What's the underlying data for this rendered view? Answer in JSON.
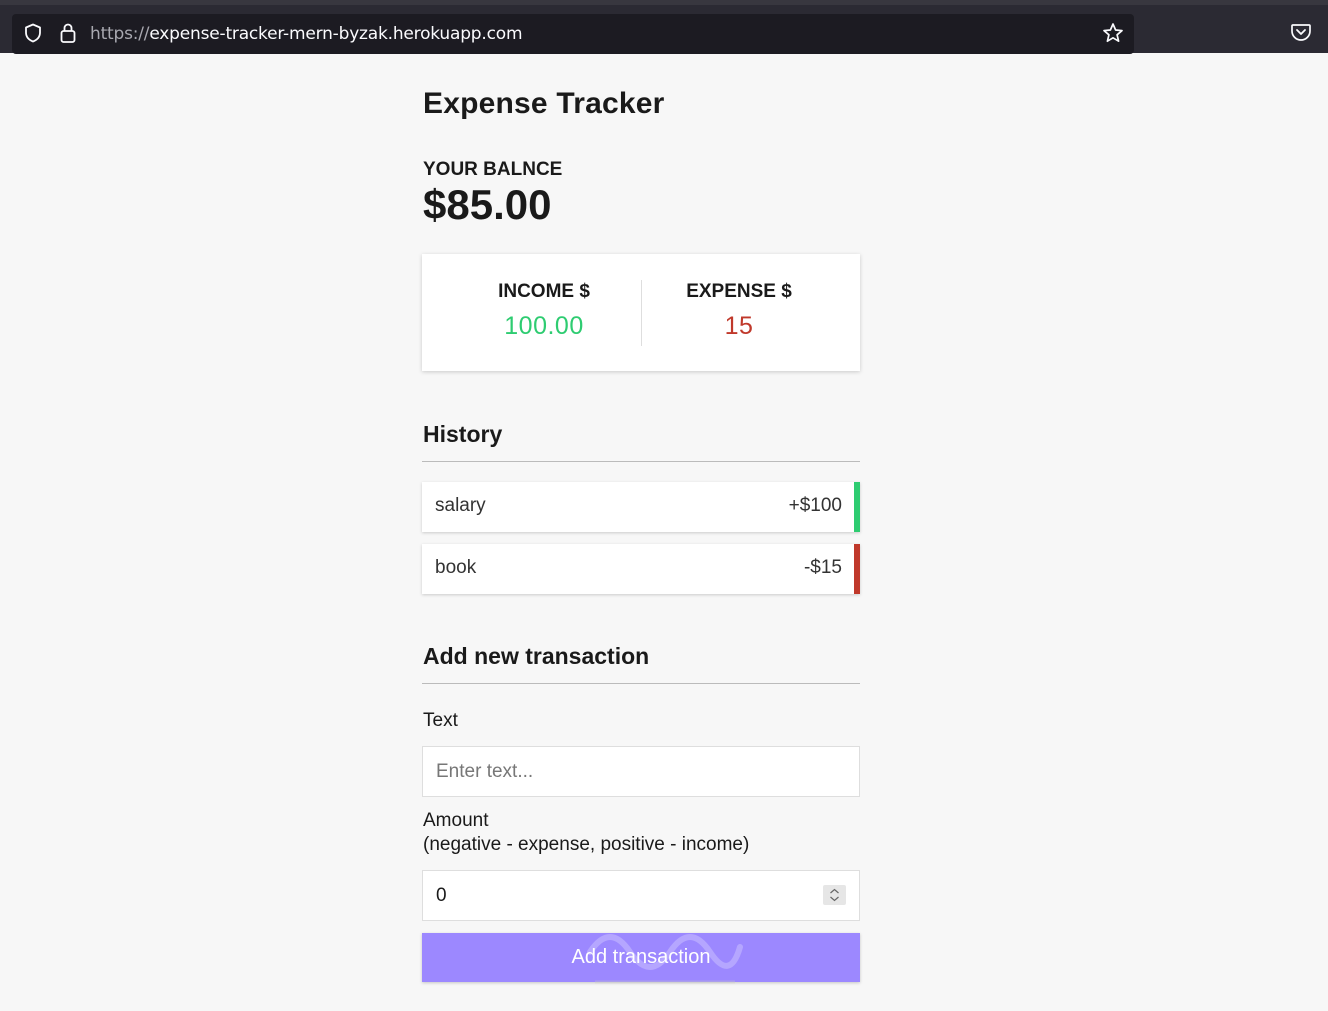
{
  "browser": {
    "url_protocol": "https://",
    "url_host": "expense-tracker-mern-byzak.herokuapp.com",
    "icons": [
      "shield-icon",
      "lock-icon",
      "star-icon",
      "pocket-icon"
    ]
  },
  "app": {
    "title": "Expense Tracker",
    "balance_label": "YOUR BALNCE",
    "balance_value": "$85.00"
  },
  "summary": {
    "income_label": "INCOME $",
    "income_value": "100.00",
    "expense_label": "EXPENSE $",
    "expense_value": "15"
  },
  "history": {
    "title": "History",
    "items": [
      {
        "text": "salary",
        "amount": "+$100",
        "type": "plus"
      },
      {
        "text": "book",
        "amount": "-$15",
        "type": "minus"
      }
    ]
  },
  "form": {
    "title": "Add new transaction",
    "text_label": "Text",
    "text_placeholder": "Enter text...",
    "amount_label": "Amount",
    "amount_hint": "(negative - expense, positive - income)",
    "amount_value": "0",
    "submit_label": "Add transaction"
  },
  "colors": {
    "income": "#2ecc71",
    "expense": "#c0392b",
    "button": "#9c88ff"
  }
}
